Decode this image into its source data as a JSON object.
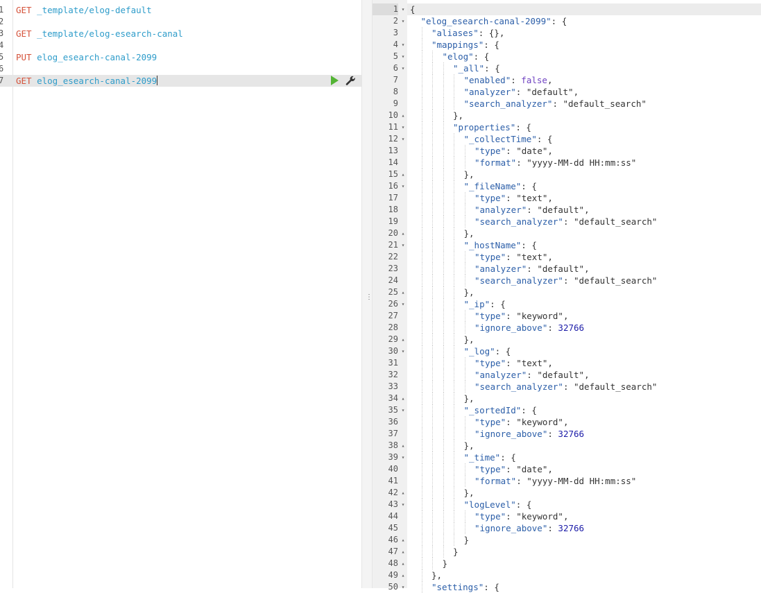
{
  "request_editor": {
    "lines": [
      {
        "n": "1",
        "method": "GET",
        "path": "_template/elog-default"
      },
      {
        "n": "2",
        "method": "",
        "path": ""
      },
      {
        "n": "3",
        "method": "GET",
        "path": "_template/elog-esearch-canal"
      },
      {
        "n": "4",
        "method": "",
        "path": ""
      },
      {
        "n": "5",
        "method": "PUT",
        "path": "elog_esearch-canal-2099"
      },
      {
        "n": "6",
        "method": "",
        "path": ""
      },
      {
        "n": "7",
        "method": "GET",
        "path": "elog_esearch-canal-2099",
        "active": true
      }
    ],
    "actions": {
      "run": "play-icon",
      "settings": "wrench-icon"
    },
    "colors": {
      "method": "#d5533b",
      "path": "#2e9cca",
      "play": "#54b435"
    }
  },
  "response_output": {
    "lines": [
      {
        "n": "1",
        "fold": "▾",
        "indent": 0,
        "parts": [
          [
            "p",
            "{"
          ]
        ],
        "active": true
      },
      {
        "n": "2",
        "fold": "▾",
        "indent": 1,
        "parts": [
          [
            "k",
            "\"elog_esearch-canal-2099\""
          ],
          [
            "p",
            ": {"
          ]
        ]
      },
      {
        "n": "3",
        "fold": "",
        "indent": 2,
        "parts": [
          [
            "k",
            "\"aliases\""
          ],
          [
            "p",
            ": {},"
          ]
        ]
      },
      {
        "n": "4",
        "fold": "▾",
        "indent": 2,
        "parts": [
          [
            "k",
            "\"mappings\""
          ],
          [
            "p",
            ": {"
          ]
        ]
      },
      {
        "n": "5",
        "fold": "▾",
        "indent": 3,
        "parts": [
          [
            "k",
            "\"elog\""
          ],
          [
            "p",
            ": {"
          ]
        ]
      },
      {
        "n": "6",
        "fold": "▾",
        "indent": 4,
        "parts": [
          [
            "k",
            "\"_all\""
          ],
          [
            "p",
            ": {"
          ]
        ]
      },
      {
        "n": "7",
        "fold": "",
        "indent": 5,
        "parts": [
          [
            "k",
            "\"enabled\""
          ],
          [
            "p",
            ": "
          ],
          [
            "b",
            "false"
          ],
          [
            "p",
            ","
          ]
        ]
      },
      {
        "n": "8",
        "fold": "",
        "indent": 5,
        "parts": [
          [
            "k",
            "\"analyzer\""
          ],
          [
            "p",
            ": "
          ],
          [
            "s",
            "\"default\""
          ],
          [
            "p",
            ","
          ]
        ]
      },
      {
        "n": "9",
        "fold": "",
        "indent": 5,
        "parts": [
          [
            "k",
            "\"search_analyzer\""
          ],
          [
            "p",
            ": "
          ],
          [
            "s",
            "\"default_search\""
          ]
        ]
      },
      {
        "n": "10",
        "fold": "▴",
        "indent": 4,
        "parts": [
          [
            "p",
            "},"
          ]
        ]
      },
      {
        "n": "11",
        "fold": "▾",
        "indent": 4,
        "parts": [
          [
            "k",
            "\"properties\""
          ],
          [
            "p",
            ": {"
          ]
        ]
      },
      {
        "n": "12",
        "fold": "▾",
        "indent": 5,
        "parts": [
          [
            "k",
            "\"_collectTime\""
          ],
          [
            "p",
            ": {"
          ]
        ]
      },
      {
        "n": "13",
        "fold": "",
        "indent": 6,
        "parts": [
          [
            "k",
            "\"type\""
          ],
          [
            "p",
            ": "
          ],
          [
            "s",
            "\"date\""
          ],
          [
            "p",
            ","
          ]
        ]
      },
      {
        "n": "14",
        "fold": "",
        "indent": 6,
        "parts": [
          [
            "k",
            "\"format\""
          ],
          [
            "p",
            ": "
          ],
          [
            "s",
            "\"yyyy-MM-dd HH:mm:ss\""
          ]
        ]
      },
      {
        "n": "15",
        "fold": "▴",
        "indent": 5,
        "parts": [
          [
            "p",
            "},"
          ]
        ]
      },
      {
        "n": "16",
        "fold": "▾",
        "indent": 5,
        "parts": [
          [
            "k",
            "\"_fileName\""
          ],
          [
            "p",
            ": {"
          ]
        ]
      },
      {
        "n": "17",
        "fold": "",
        "indent": 6,
        "parts": [
          [
            "k",
            "\"type\""
          ],
          [
            "p",
            ": "
          ],
          [
            "s",
            "\"text\""
          ],
          [
            "p",
            ","
          ]
        ]
      },
      {
        "n": "18",
        "fold": "",
        "indent": 6,
        "parts": [
          [
            "k",
            "\"analyzer\""
          ],
          [
            "p",
            ": "
          ],
          [
            "s",
            "\"default\""
          ],
          [
            "p",
            ","
          ]
        ]
      },
      {
        "n": "19",
        "fold": "",
        "indent": 6,
        "parts": [
          [
            "k",
            "\"search_analyzer\""
          ],
          [
            "p",
            ": "
          ],
          [
            "s",
            "\"default_search\""
          ]
        ]
      },
      {
        "n": "20",
        "fold": "▴",
        "indent": 5,
        "parts": [
          [
            "p",
            "},"
          ]
        ]
      },
      {
        "n": "21",
        "fold": "▾",
        "indent": 5,
        "parts": [
          [
            "k",
            "\"_hostName\""
          ],
          [
            "p",
            ": {"
          ]
        ]
      },
      {
        "n": "22",
        "fold": "",
        "indent": 6,
        "parts": [
          [
            "k",
            "\"type\""
          ],
          [
            "p",
            ": "
          ],
          [
            "s",
            "\"text\""
          ],
          [
            "p",
            ","
          ]
        ]
      },
      {
        "n": "23",
        "fold": "",
        "indent": 6,
        "parts": [
          [
            "k",
            "\"analyzer\""
          ],
          [
            "p",
            ": "
          ],
          [
            "s",
            "\"default\""
          ],
          [
            "p",
            ","
          ]
        ]
      },
      {
        "n": "24",
        "fold": "",
        "indent": 6,
        "parts": [
          [
            "k",
            "\"search_analyzer\""
          ],
          [
            "p",
            ": "
          ],
          [
            "s",
            "\"default_search\""
          ]
        ]
      },
      {
        "n": "25",
        "fold": "▴",
        "indent": 5,
        "parts": [
          [
            "p",
            "},"
          ]
        ]
      },
      {
        "n": "26",
        "fold": "▾",
        "indent": 5,
        "parts": [
          [
            "k",
            "\"_ip\""
          ],
          [
            "p",
            ": {"
          ]
        ]
      },
      {
        "n": "27",
        "fold": "",
        "indent": 6,
        "parts": [
          [
            "k",
            "\"type\""
          ],
          [
            "p",
            ": "
          ],
          [
            "s",
            "\"keyword\""
          ],
          [
            "p",
            ","
          ]
        ]
      },
      {
        "n": "28",
        "fold": "",
        "indent": 6,
        "parts": [
          [
            "k",
            "\"ignore_above\""
          ],
          [
            "p",
            ": "
          ],
          [
            "n",
            "32766"
          ]
        ]
      },
      {
        "n": "29",
        "fold": "▴",
        "indent": 5,
        "parts": [
          [
            "p",
            "},"
          ]
        ]
      },
      {
        "n": "30",
        "fold": "▾",
        "indent": 5,
        "parts": [
          [
            "k",
            "\"_log\""
          ],
          [
            "p",
            ": {"
          ]
        ]
      },
      {
        "n": "31",
        "fold": "",
        "indent": 6,
        "parts": [
          [
            "k",
            "\"type\""
          ],
          [
            "p",
            ": "
          ],
          [
            "s",
            "\"text\""
          ],
          [
            "p",
            ","
          ]
        ]
      },
      {
        "n": "32",
        "fold": "",
        "indent": 6,
        "parts": [
          [
            "k",
            "\"analyzer\""
          ],
          [
            "p",
            ": "
          ],
          [
            "s",
            "\"default\""
          ],
          [
            "p",
            ","
          ]
        ]
      },
      {
        "n": "33",
        "fold": "",
        "indent": 6,
        "parts": [
          [
            "k",
            "\"search_analyzer\""
          ],
          [
            "p",
            ": "
          ],
          [
            "s",
            "\"default_search\""
          ]
        ]
      },
      {
        "n": "34",
        "fold": "▴",
        "indent": 5,
        "parts": [
          [
            "p",
            "},"
          ]
        ]
      },
      {
        "n": "35",
        "fold": "▾",
        "indent": 5,
        "parts": [
          [
            "k",
            "\"_sortedId\""
          ],
          [
            "p",
            ": {"
          ]
        ]
      },
      {
        "n": "36",
        "fold": "",
        "indent": 6,
        "parts": [
          [
            "k",
            "\"type\""
          ],
          [
            "p",
            ": "
          ],
          [
            "s",
            "\"keyword\""
          ],
          [
            "p",
            ","
          ]
        ]
      },
      {
        "n": "37",
        "fold": "",
        "indent": 6,
        "parts": [
          [
            "k",
            "\"ignore_above\""
          ],
          [
            "p",
            ": "
          ],
          [
            "n",
            "32766"
          ]
        ]
      },
      {
        "n": "38",
        "fold": "▴",
        "indent": 5,
        "parts": [
          [
            "p",
            "},"
          ]
        ]
      },
      {
        "n": "39",
        "fold": "▾",
        "indent": 5,
        "parts": [
          [
            "k",
            "\"_time\""
          ],
          [
            "p",
            ": {"
          ]
        ]
      },
      {
        "n": "40",
        "fold": "",
        "indent": 6,
        "parts": [
          [
            "k",
            "\"type\""
          ],
          [
            "p",
            ": "
          ],
          [
            "s",
            "\"date\""
          ],
          [
            "p",
            ","
          ]
        ]
      },
      {
        "n": "41",
        "fold": "",
        "indent": 6,
        "parts": [
          [
            "k",
            "\"format\""
          ],
          [
            "p",
            ": "
          ],
          [
            "s",
            "\"yyyy-MM-dd HH:mm:ss\""
          ]
        ]
      },
      {
        "n": "42",
        "fold": "▴",
        "indent": 5,
        "parts": [
          [
            "p",
            "},"
          ]
        ]
      },
      {
        "n": "43",
        "fold": "▾",
        "indent": 5,
        "parts": [
          [
            "k",
            "\"logLevel\""
          ],
          [
            "p",
            ": {"
          ]
        ]
      },
      {
        "n": "44",
        "fold": "",
        "indent": 6,
        "parts": [
          [
            "k",
            "\"type\""
          ],
          [
            "p",
            ": "
          ],
          [
            "s",
            "\"keyword\""
          ],
          [
            "p",
            ","
          ]
        ]
      },
      {
        "n": "45",
        "fold": "",
        "indent": 6,
        "parts": [
          [
            "k",
            "\"ignore_above\""
          ],
          [
            "p",
            ": "
          ],
          [
            "n",
            "32766"
          ]
        ]
      },
      {
        "n": "46",
        "fold": "▴",
        "indent": 5,
        "parts": [
          [
            "p",
            "}"
          ]
        ]
      },
      {
        "n": "47",
        "fold": "▴",
        "indent": 4,
        "parts": [
          [
            "p",
            "}"
          ]
        ]
      },
      {
        "n": "48",
        "fold": "▴",
        "indent": 3,
        "parts": [
          [
            "p",
            "}"
          ]
        ]
      },
      {
        "n": "49",
        "fold": "▴",
        "indent": 2,
        "parts": [
          [
            "p",
            "},"
          ]
        ]
      },
      {
        "n": "50",
        "fold": "▾",
        "indent": 2,
        "parts": [
          [
            "k",
            "\"settings\""
          ],
          [
            "p",
            ": {"
          ]
        ]
      }
    ],
    "colors": {
      "key": "#2b5ea8",
      "bool": "#6f42c1",
      "number": "#1c1ca8",
      "gutter": "#f0f0f0"
    }
  },
  "splitter": {
    "icon": "grip-icon"
  }
}
